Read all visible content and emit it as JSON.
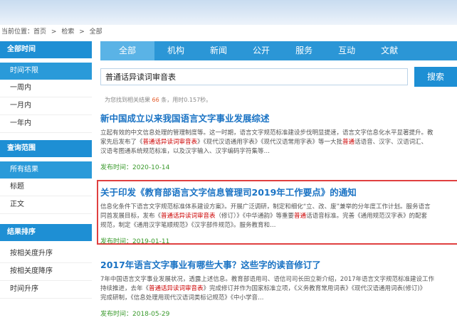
{
  "breadcrumb": [
    "当前位置：首页",
    ">",
    "检索",
    ">",
    "全部"
  ],
  "sidebar": {
    "sections": [
      {
        "title": "全部时间",
        "items": [
          {
            "label": "时间不限",
            "active": true
          },
          {
            "label": "一周内"
          },
          {
            "label": "一月内"
          },
          {
            "label": "一年内"
          }
        ]
      },
      {
        "title": "查询范围",
        "items": [
          {
            "label": "所有结果",
            "active": true
          },
          {
            "label": "标题"
          },
          {
            "label": "正文"
          }
        ]
      },
      {
        "title": "结果排序",
        "items": [
          {
            "label": "按相关度升序"
          },
          {
            "label": "按相关度降序"
          },
          {
            "label": "时间升序"
          }
        ]
      }
    ]
  },
  "tabs": [
    "全部",
    "机构",
    "新闻",
    "公开",
    "服务",
    "互动",
    "文献"
  ],
  "search": {
    "query": "普通话异读词审音表",
    "button": "搜索"
  },
  "stats": {
    "prefix": "为您找到相关结果",
    "count": "66",
    "suffix": "条，用时0.157秒。"
  },
  "results": [
    {
      "title": "新中国成立以来我国语言文字事业发展综述",
      "lines": [
        [
          {
            "t": "立起有效的中文信息处理的管理制度等。这一时期，语言文字规范标准建设步伐明显提速，语言文字信息化水平显著提升。教"
          }
        ],
        [
          {
            "t": "家先后发布了《"
          },
          {
            "t": "普通话异读词审音表",
            "h": true
          },
          {
            "t": "》《现代汉语通用字表》《现代汉语常用字表》等一大批"
          },
          {
            "t": "普通",
            "h": true
          },
          {
            "t": "话语音、汉字、汉语词汇、"
          }
        ],
        [
          {
            "t": "汉语考图通系统规范标准，以及汉字输入、汉字编码字符集等…"
          }
        ]
      ],
      "date": "发布时间：2020-10-14"
    },
    {
      "title": "关于印发《教育部语言文字信息管理司2019年工作要点》的通知",
      "lines": [
        [
          {
            "t": "信息化条件下语言文字规范标准体系建设方案》。开展广泛调研，制定和细化“立、改、废”兼举的分年度工作计划。服务语言"
          }
        ],
        [
          {
            "t": "同首发展目标，发布《"
          },
          {
            "t": "普通话异读词审音表",
            "h": true
          },
          {
            "t": "（修订）》《中华通韵》等重要"
          },
          {
            "t": "普通",
            "h": true
          },
          {
            "t": "话语音标准。完善《通用规范汉字表》的配套"
          }
        ],
        [
          {
            "t": "规范，制定《通用汉字笔顺规范》《汉字部件规范》。服务教育和…"
          }
        ]
      ],
      "date": "发布时间：2019-01-11"
    },
    {
      "title": "2017年语言文字事业有哪些大事？这些字的读音修订了",
      "lines": [
        [
          {
            "t": "7年中国语言文字事业发展状况，透露上述信息。教育部语用司、语信司司长田立新介绍，2017年语言文字规范标准建设工作"
          }
        ],
        [
          {
            "t": "持续推进，去年《"
          },
          {
            "t": "普通话异读词审音表",
            "h": true
          },
          {
            "t": "》完成修订并作为国家标准立项，《义务教育常用词表》《现代汉语通用词表(修订)》"
          }
        ],
        [
          {
            "t": "完成研制，《信息处理用现代汉语词类标记规范》《中小学音…"
          }
        ]
      ],
      "date": "发布时间：2018-05-29"
    }
  ]
}
